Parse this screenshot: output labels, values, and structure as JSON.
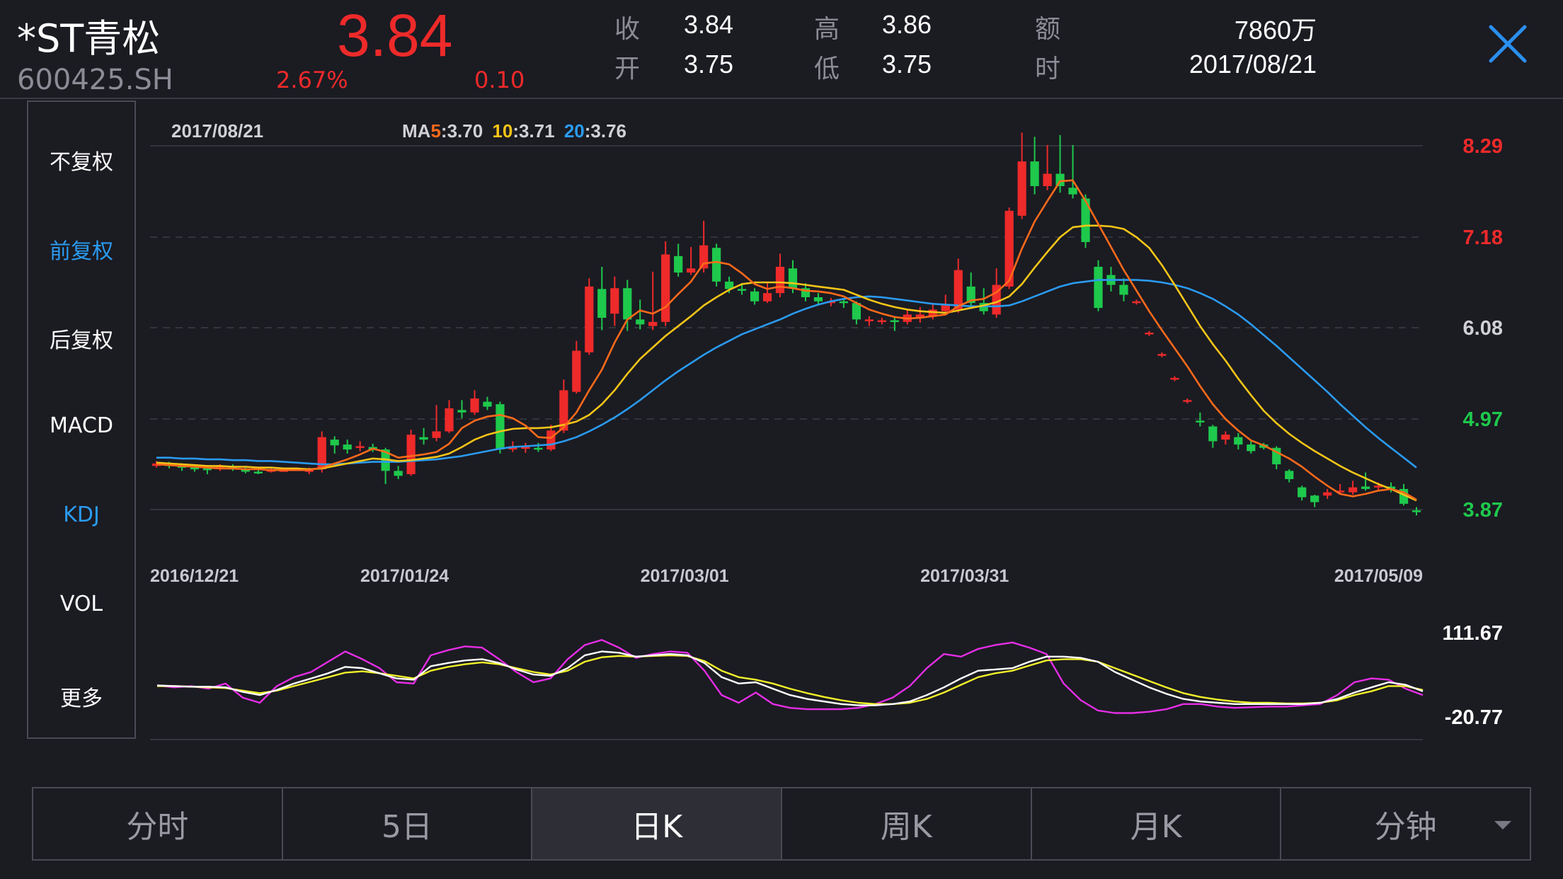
{
  "stock": {
    "name": "*ST青松",
    "code": "600425.SH",
    "price": "3.84",
    "change_pct": "2.67%",
    "change": "0.10"
  },
  "quote": {
    "close_label": "收",
    "close": "3.84",
    "open_label": "开",
    "open": "3.75",
    "high_label": "高",
    "high": "3.86",
    "low_label": "低",
    "low": "3.75",
    "amount_label": "额",
    "amount": "7860万",
    "time_label": "时",
    "time": "2017/08/21"
  },
  "side_menu": [
    {
      "label": "不复权",
      "active": false
    },
    {
      "label": "前复权",
      "active": true
    },
    {
      "label": "后复权",
      "active": false
    },
    {
      "label": "MACD",
      "active": false
    },
    {
      "label": "KDJ",
      "active": true
    },
    {
      "label": "VOL",
      "active": false
    },
    {
      "label": "更多",
      "active": false
    }
  ],
  "overlay": {
    "date": "2017/08/21",
    "ma_label": "MA",
    "ma5_key": "5",
    "ma5_val": ":3.70",
    "ma10_key": "10",
    "ma10_val": ":3.71",
    "ma20_key": "20",
    "ma20_val": ":3.76"
  },
  "tabs": [
    {
      "label": "分时",
      "active": false
    },
    {
      "label": "5日",
      "active": false
    },
    {
      "label": "日K",
      "active": true
    },
    {
      "label": "周K",
      "active": false
    },
    {
      "label": "月K",
      "active": false
    },
    {
      "label": "分钟",
      "active": false,
      "dropdown": true
    }
  ],
  "colors": {
    "up": "#ee2a2a",
    "down": "#1ec94c",
    "ma5": "#ff6a1a",
    "ma10": "#f5c518",
    "ma20": "#2a9bf0",
    "k": "#ffffff",
    "d": "#f2f22a",
    "j": "#e62ee6",
    "accent": "#2a9bf0",
    "background": "#1b1b22"
  },
  "chart_data": {
    "type": "candlestick",
    "y_ticks": [
      {
        "value": 8.29,
        "label": "8.29",
        "color": "#ee2a2a"
      },
      {
        "value": 7.18,
        "label": "7.18",
        "color": "#ee2a2a"
      },
      {
        "value": 6.08,
        "label": "6.08",
        "color": "#d0d0d6"
      },
      {
        "value": 4.97,
        "label": "4.97",
        "color": "#1ec94c"
      },
      {
        "value": 3.87,
        "label": "3.87",
        "color": "#1ec94c"
      }
    ],
    "ylim": [
      3.87,
      8.29
    ],
    "x_ticks": [
      {
        "index": 0,
        "label": "2016/12/21"
      },
      {
        "index": 20,
        "label": "2017/01/24"
      },
      {
        "index": 42,
        "label": "2017/03/01"
      },
      {
        "index": 64,
        "label": "2017/03/31"
      },
      {
        "index": 90,
        "label": "2017/05/09"
      }
    ],
    "candles": [
      [
        4.4,
        4.43,
        4.46,
        4.38
      ],
      [
        4.42,
        4.4,
        4.45,
        4.37
      ],
      [
        4.4,
        4.38,
        4.43,
        4.34
      ],
      [
        4.38,
        4.36,
        4.4,
        4.33
      ],
      [
        4.37,
        4.36,
        4.4,
        4.3
      ],
      [
        4.36,
        4.39,
        4.42,
        4.34
      ],
      [
        4.38,
        4.36,
        4.42,
        4.34
      ],
      [
        4.36,
        4.33,
        4.39,
        4.31
      ],
      [
        4.33,
        4.32,
        4.36,
        4.3
      ],
      [
        4.33,
        4.35,
        4.37,
        4.32
      ],
      [
        4.35,
        4.35,
        4.38,
        4.33
      ],
      [
        4.36,
        4.36,
        4.38,
        4.34
      ],
      [
        4.35,
        4.35,
        4.38,
        4.3
      ],
      [
        4.36,
        4.75,
        4.82,
        4.32
      ],
      [
        4.72,
        4.65,
        4.76,
        4.55
      ],
      [
        4.66,
        4.6,
        4.72,
        4.55
      ],
      [
        4.62,
        4.64,
        4.7,
        4.58
      ],
      [
        4.63,
        4.6,
        4.67,
        4.57
      ],
      [
        4.6,
        4.34,
        4.62,
        4.18
      ],
      [
        4.34,
        4.28,
        4.4,
        4.24
      ],
      [
        4.3,
        4.78,
        4.84,
        4.28
      ],
      [
        4.75,
        4.72,
        4.86,
        4.66
      ],
      [
        4.74,
        4.82,
        5.14,
        4.7
      ],
      [
        4.82,
        5.1,
        5.2,
        4.8
      ],
      [
        5.08,
        5.05,
        5.2,
        4.98
      ],
      [
        5.05,
        5.22,
        5.32,
        5.02
      ],
      [
        5.18,
        5.12,
        5.24,
        5.08
      ],
      [
        5.15,
        4.6,
        5.18,
        4.55
      ],
      [
        4.6,
        4.64,
        4.7,
        4.57
      ],
      [
        4.63,
        4.63,
        4.68,
        4.56
      ],
      [
        4.62,
        4.6,
        4.68,
        4.57
      ],
      [
        4.6,
        4.83,
        4.9,
        4.58
      ],
      [
        4.83,
        5.32,
        5.45,
        4.8
      ],
      [
        5.3,
        5.8,
        5.92,
        5.28
      ],
      [
        5.78,
        6.58,
        6.68,
        5.75
      ],
      [
        6.55,
        6.2,
        6.82,
        6.05
      ],
      [
        6.25,
        6.56,
        6.7,
        6.1
      ],
      [
        6.56,
        6.18,
        6.66,
        6.04
      ],
      [
        6.18,
        6.12,
        6.42,
        6.06
      ],
      [
        6.1,
        6.15,
        6.76,
        6.05
      ],
      [
        6.15,
        6.97,
        7.13,
        6.1
      ],
      [
        6.95,
        6.75,
        7.1,
        6.7
      ],
      [
        6.75,
        6.8,
        7.06,
        6.72
      ],
      [
        6.8,
        7.08,
        7.38,
        6.75
      ],
      [
        7.05,
        6.64,
        7.1,
        6.58
      ],
      [
        6.64,
        6.55,
        6.7,
        6.5
      ],
      [
        6.55,
        6.54,
        6.62,
        6.48
      ],
      [
        6.52,
        6.4,
        6.56,
        6.36
      ],
      [
        6.4,
        6.5,
        6.62,
        6.38
      ],
      [
        6.5,
        6.82,
        6.98,
        6.45
      ],
      [
        6.8,
        6.56,
        6.9,
        6.5
      ],
      [
        6.56,
        6.45,
        6.62,
        6.4
      ],
      [
        6.45,
        6.4,
        6.5,
        6.35
      ],
      [
        6.4,
        6.4,
        6.44,
        6.34
      ],
      [
        6.4,
        6.38,
        6.42,
        6.32
      ],
      [
        6.38,
        6.18,
        6.4,
        6.12
      ],
      [
        6.18,
        6.18,
        6.22,
        6.1
      ],
      [
        6.16,
        6.17,
        6.2,
        6.12
      ],
      [
        6.17,
        6.16,
        6.22,
        6.04
      ],
      [
        6.15,
        6.24,
        6.3,
        6.12
      ],
      [
        6.2,
        6.24,
        6.33,
        6.14
      ],
      [
        6.22,
        6.3,
        6.38,
        6.18
      ],
      [
        6.28,
        6.36,
        6.48,
        6.24
      ],
      [
        6.3,
        6.78,
        6.92,
        6.26
      ],
      [
        6.58,
        6.38,
        6.75,
        6.32
      ],
      [
        6.38,
        6.28,
        6.56,
        6.24
      ],
      [
        6.24,
        6.6,
        6.8,
        6.2
      ],
      [
        6.58,
        7.5,
        7.54,
        6.55
      ],
      [
        7.44,
        8.1,
        8.45,
        7.4
      ],
      [
        8.1,
        7.8,
        8.4,
        7.7
      ],
      [
        7.8,
        7.95,
        8.3,
        7.75
      ],
      [
        7.95,
        7.8,
        8.42,
        7.72
      ],
      [
        7.78,
        7.7,
        8.3,
        7.65
      ],
      [
        7.65,
        7.12,
        7.7,
        7.05
      ],
      [
        6.82,
        6.32,
        6.9,
        6.28
      ],
      [
        6.72,
        6.6,
        6.82,
        6.52
      ],
      [
        6.6,
        6.48,
        6.68,
        6.4
      ],
      [
        6.38,
        6.4,
        6.42,
        6.36
      ],
      [
        6.0,
        6.02,
        6.04,
        5.98
      ],
      [
        5.74,
        5.76,
        5.78,
        5.72
      ],
      [
        5.45,
        5.47,
        5.49,
        5.43
      ],
      [
        5.18,
        5.2,
        5.22,
        5.16
      ],
      [
        4.95,
        4.93,
        5.05,
        4.88
      ],
      [
        4.88,
        4.7,
        4.9,
        4.62
      ],
      [
        4.72,
        4.78,
        4.82,
        4.66
      ],
      [
        4.75,
        4.66,
        4.8,
        4.6
      ],
      [
        4.66,
        4.58,
        4.7,
        4.55
      ],
      [
        4.66,
        4.62,
        4.68,
        4.6
      ],
      [
        4.62,
        4.42,
        4.64,
        4.36
      ],
      [
        4.34,
        4.24,
        4.36,
        4.2
      ],
      [
        4.14,
        4.02,
        4.16,
        3.98
      ],
      [
        4.04,
        3.96,
        4.05,
        3.9
      ],
      [
        4.04,
        4.08,
        4.12,
        4.0
      ],
      [
        4.08,
        4.1,
        4.18,
        4.06
      ],
      [
        4.08,
        4.14,
        4.22,
        4.05
      ],
      [
        4.15,
        4.12,
        4.32,
        4.1
      ],
      [
        4.14,
        4.16,
        4.2,
        4.1
      ],
      [
        4.15,
        4.12,
        4.2,
        4.08
      ],
      [
        4.12,
        3.94,
        4.18,
        3.92
      ],
      [
        3.86,
        3.84,
        3.9,
        3.8
      ]
    ],
    "ma5": [
      4.42,
      4.41,
      4.4,
      4.39,
      4.38,
      4.37,
      4.37,
      4.36,
      4.36,
      4.35,
      4.35,
      4.35,
      4.35,
      4.38,
      4.43,
      4.48,
      4.54,
      4.61,
      4.57,
      4.5,
      4.52,
      4.54,
      4.57,
      4.67,
      4.86,
      4.95,
      5.0,
      5.02,
      4.98,
      4.89,
      4.75,
      4.74,
      4.87,
      5.05,
      5.32,
      5.57,
      5.9,
      6.18,
      6.29,
      6.25,
      6.33,
      6.49,
      6.64,
      6.86,
      6.88,
      6.85,
      6.74,
      6.61,
      6.55,
      6.58,
      6.56,
      6.53,
      6.52,
      6.5,
      6.46,
      6.38,
      6.3,
      6.25,
      6.21,
      6.19,
      6.2,
      6.22,
      6.24,
      6.34,
      6.41,
      6.43,
      6.51,
      6.65,
      7.04,
      7.37,
      7.62,
      7.86,
      7.87,
      7.62,
      7.34,
      7.06,
      6.78,
      6.53,
      6.28,
      6.05,
      5.83,
      5.61,
      5.37,
      5.15,
      4.97,
      4.83,
      4.71,
      4.65,
      4.57,
      4.49,
      4.39,
      4.27,
      4.16,
      4.06,
      4.03,
      4.06,
      4.1,
      4.12,
      4.08,
      3.99
    ],
    "ma10": [
      4.44,
      4.43,
      4.42,
      4.41,
      4.4,
      4.4,
      4.39,
      4.39,
      4.38,
      4.38,
      4.37,
      4.37,
      4.36,
      4.37,
      4.4,
      4.43,
      4.46,
      4.49,
      4.48,
      4.46,
      4.47,
      4.49,
      4.51,
      4.55,
      4.63,
      4.72,
      4.78,
      4.82,
      4.85,
      4.86,
      4.86,
      4.87,
      4.9,
      4.94,
      5.02,
      5.15,
      5.32,
      5.52,
      5.7,
      5.84,
      5.98,
      6.1,
      6.22,
      6.35,
      6.45,
      6.54,
      6.61,
      6.63,
      6.63,
      6.63,
      6.62,
      6.6,
      6.58,
      6.56,
      6.54,
      6.48,
      6.42,
      6.37,
      6.33,
      6.3,
      6.28,
      6.27,
      6.26,
      6.29,
      6.32,
      6.35,
      6.39,
      6.46,
      6.61,
      6.81,
      7.0,
      7.18,
      7.3,
      7.32,
      7.32,
      7.31,
      7.28,
      7.18,
      7.05,
      6.84,
      6.6,
      6.35,
      6.1,
      5.88,
      5.68,
      5.46,
      5.26,
      5.07,
      4.92,
      4.79,
      4.68,
      4.58,
      4.49,
      4.4,
      4.32,
      4.25,
      4.18,
      4.12,
      4.05,
      3.98
    ],
    "ma20": [
      4.5,
      4.5,
      4.49,
      4.49,
      4.48,
      4.48,
      4.47,
      4.47,
      4.46,
      4.46,
      4.45,
      4.44,
      4.43,
      4.42,
      4.42,
      4.43,
      4.44,
      4.45,
      4.45,
      4.45,
      4.46,
      4.47,
      4.48,
      4.5,
      4.52,
      4.55,
      4.58,
      4.61,
      4.63,
      4.64,
      4.65,
      4.66,
      4.7,
      4.75,
      4.82,
      4.9,
      4.99,
      5.09,
      5.2,
      5.32,
      5.44,
      5.55,
      5.65,
      5.75,
      5.84,
      5.92,
      6.0,
      6.06,
      6.12,
      6.18,
      6.25,
      6.31,
      6.36,
      6.4,
      6.43,
      6.45,
      6.46,
      6.45,
      6.43,
      6.41,
      6.39,
      6.37,
      6.36,
      6.35,
      6.34,
      6.34,
      6.34,
      6.35,
      6.4,
      6.46,
      6.52,
      6.58,
      6.62,
      6.64,
      6.66,
      6.66,
      6.66,
      6.66,
      6.65,
      6.63,
      6.6,
      6.56,
      6.5,
      6.43,
      6.34,
      6.24,
      6.12,
      5.99,
      5.86,
      5.72,
      5.58,
      5.44,
      5.3,
      5.15,
      5.01,
      4.87,
      4.74,
      4.62,
      4.5,
      4.38
    ],
    "kdj": {
      "ylim": [
        -20.77,
        111.67
      ],
      "y_ticks": [
        111.67,
        -20.77
      ],
      "k": [
        25,
        24,
        23,
        23,
        22,
        15,
        10,
        18,
        28,
        36,
        44,
        54,
        52,
        44,
        36,
        34,
        55,
        60,
        64,
        66,
        60,
        50,
        42,
        40,
        52,
        72,
        78,
        76,
        70,
        72,
        74,
        72,
        60,
        38,
        28,
        30,
        20,
        10,
        4,
        0,
        -4,
        -6,
        -6,
        -4,
        0,
        10,
        22,
        36,
        48,
        50,
        52,
        62,
        70,
        70,
        68,
        62,
        46,
        34,
        22,
        12,
        4,
        0,
        -2,
        -4,
        -4,
        -4,
        -4,
        -4,
        -2,
        4,
        14,
        22,
        30,
        26,
        16
      ],
      "d": [
        24,
        24,
        23,
        22,
        21,
        17,
        13,
        17,
        24,
        31,
        38,
        45,
        47,
        44,
        40,
        36,
        48,
        54,
        58,
        61,
        58,
        52,
        46,
        42,
        48,
        62,
        69,
        71,
        70,
        71,
        72,
        71,
        63,
        48,
        38,
        34,
        28,
        20,
        13,
        7,
        2,
        -2,
        -4,
        -4,
        -2,
        4,
        14,
        26,
        38,
        44,
        48,
        56,
        64,
        66,
        66,
        62,
        52,
        42,
        32,
        22,
        13,
        7,
        3,
        0,
        -2,
        -2,
        -3,
        -3,
        -2,
        2,
        10,
        16,
        24,
        24,
        18
      ],
      "j": [
        25,
        22,
        24,
        20,
        28,
        6,
        -2,
        24,
        38,
        46,
        62,
        78,
        66,
        52,
        30,
        28,
        72,
        80,
        86,
        84,
        66,
        46,
        30,
        36,
        66,
        88,
        96,
        84,
        68,
        74,
        78,
        76,
        48,
        10,
        -2,
        14,
        -4,
        -10,
        -12,
        -12,
        -12,
        -10,
        -4,
        6,
        24,
        52,
        74,
        70,
        82,
        88,
        92,
        84,
        74,
        28,
        2,
        -14,
        -18,
        -18,
        -16,
        -12,
        -4,
        -4,
        -8,
        -10,
        -9,
        -8,
        -8,
        -6,
        -4,
        10,
        30,
        36,
        34,
        20,
        10
      ]
    }
  }
}
